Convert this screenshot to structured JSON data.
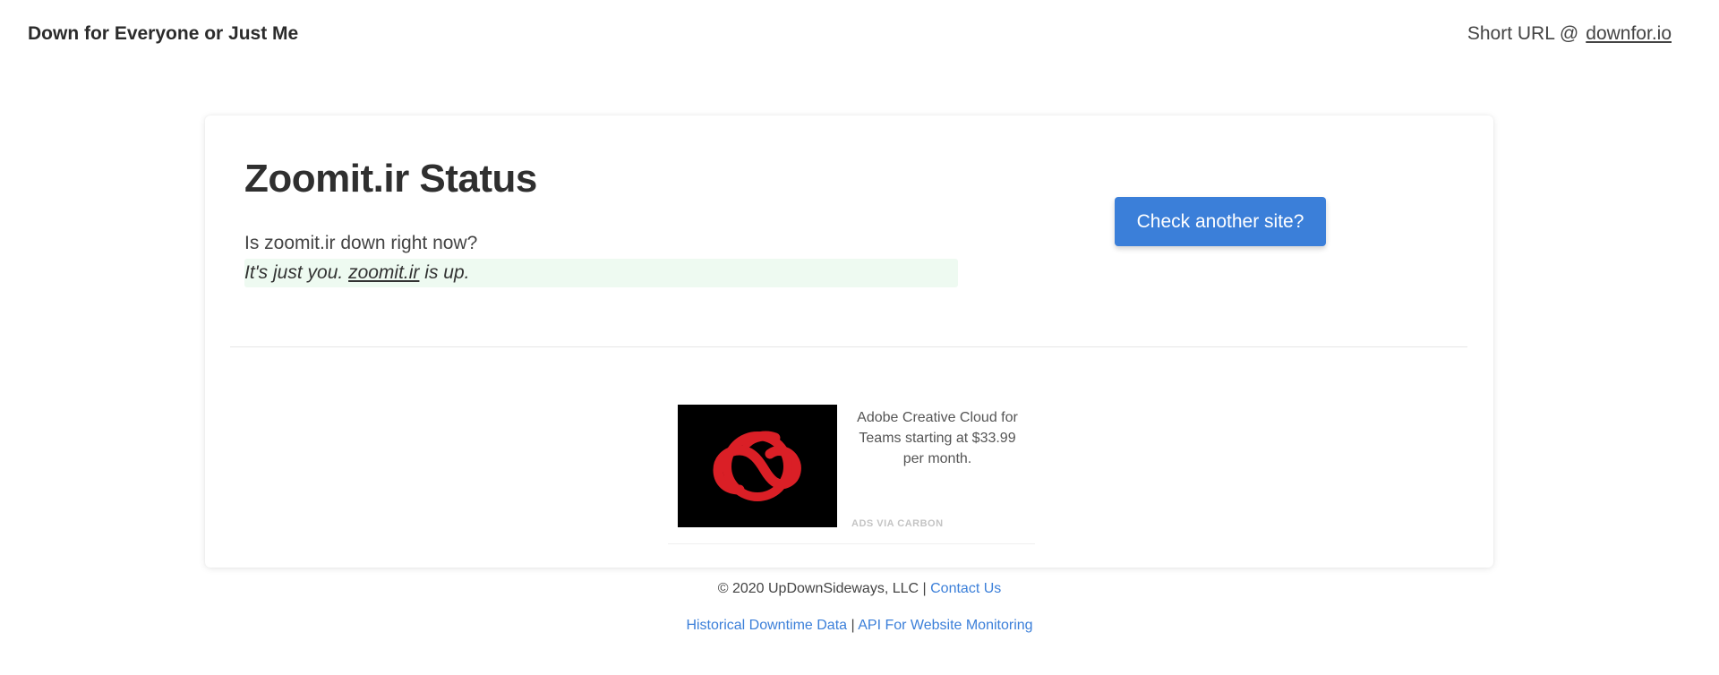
{
  "header": {
    "brand": "Down for Everyone or Just Me",
    "short_url_prefix": "Short URL @",
    "short_url_link": "downfor.io"
  },
  "status": {
    "title": "Zoomit.ir Status",
    "question": "Is zoomit.ir down right now?",
    "answer_prefix": "It's just you.",
    "answer_site": "zoomit.ir",
    "answer_suffix": "is up.",
    "check_button": "Check another site?"
  },
  "ad": {
    "image_icon": "creative-cloud-logo",
    "text": "Adobe Creative Cloud for Teams starting at $33.99 per month.",
    "via": "ADS VIA CARBON"
  },
  "footer": {
    "copyright": "© 2020 UpDownSideways, LLC |",
    "contact": "Contact Us",
    "historical": "Historical Downtime Data",
    "separator": "|",
    "api": "API For Website Monitoring"
  },
  "colors": {
    "accent": "#3b7fd9",
    "answer_bg": "#eefaf1",
    "ad_logo_red": "#da1f26"
  }
}
